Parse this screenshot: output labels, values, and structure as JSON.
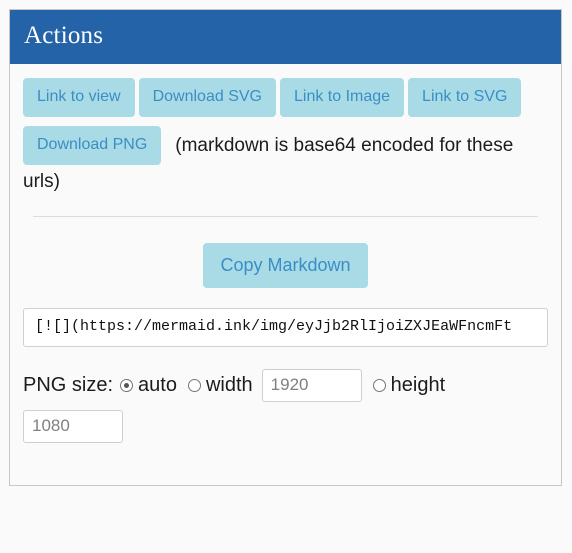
{
  "panel": {
    "title": "Actions",
    "buttons": [
      {
        "label": "Link to view",
        "name": "link-to-view-button"
      },
      {
        "label": "Download SVG",
        "name": "download-svg-button"
      },
      {
        "label": "Link to Image",
        "name": "link-to-image-button"
      },
      {
        "label": "Link to SVG",
        "name": "link-to-svg-button"
      },
      {
        "label": "Download PNG",
        "name": "download-png-button"
      }
    ],
    "hint_text": "(markdown is base64 encoded for these urls)",
    "copy_markdown_label": "Copy Markdown",
    "markdown_url": "[![](https://mermaid.ink/img/eyJjb2RlIjoiZXJEaWFncmFt",
    "png_size": {
      "label": "PNG size:",
      "auto_label": "auto",
      "auto_selected": true,
      "width_label": "width",
      "width_value": "",
      "width_placeholder": "1920",
      "width_selected": false,
      "height_label": "height",
      "height_value": "",
      "height_placeholder": "1080",
      "height_selected": false
    }
  },
  "colors": {
    "header_blue": "#2463a8",
    "button_fill": "#a9dbe6",
    "button_text": "#3a8ec6",
    "page_background": "#fafafa",
    "border_gray": "#c8c8c8"
  }
}
